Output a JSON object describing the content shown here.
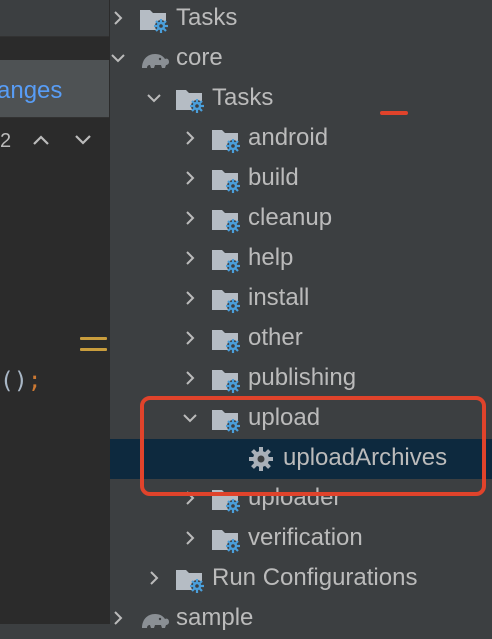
{
  "editor": {
    "changes_label": "anges",
    "change_count": "2",
    "code_tail_text": "()",
    "code_tail_semicolon": ";"
  },
  "tree": {
    "rows": [
      {
        "label": "Tasks",
        "icon": "gradle-folder-icon",
        "expanded": false,
        "level": 1
      },
      {
        "label": "core",
        "icon": "gradle-elephant-icon",
        "expanded": true,
        "level": 1
      },
      {
        "label": "Tasks",
        "icon": "gradle-folder-icon",
        "expanded": true,
        "level": 2
      },
      {
        "label": "android",
        "icon": "gradle-folder-icon",
        "expanded": false,
        "level": 3
      },
      {
        "label": "build",
        "icon": "gradle-folder-icon",
        "expanded": false,
        "level": 3
      },
      {
        "label": "cleanup",
        "icon": "gradle-folder-icon",
        "expanded": false,
        "level": 3
      },
      {
        "label": "help",
        "icon": "gradle-folder-icon",
        "expanded": false,
        "level": 3
      },
      {
        "label": "install",
        "icon": "gradle-folder-icon",
        "expanded": false,
        "level": 3
      },
      {
        "label": "other",
        "icon": "gradle-folder-icon",
        "expanded": false,
        "level": 3
      },
      {
        "label": "publishing",
        "icon": "gradle-folder-icon",
        "expanded": false,
        "level": 3
      },
      {
        "label": "upload",
        "icon": "gradle-folder-icon",
        "expanded": true,
        "level": 3
      },
      {
        "label": "uploadArchives",
        "icon": "gear-icon",
        "expanded": null,
        "level": 4
      },
      {
        "label": "uploader",
        "icon": "gradle-folder-icon",
        "expanded": false,
        "level": 3
      },
      {
        "label": "verification",
        "icon": "gradle-folder-icon",
        "expanded": false,
        "level": 3
      },
      {
        "label": "Run Configurations",
        "icon": "gradle-folder-icon",
        "expanded": false,
        "level": 2
      },
      {
        "label": "sample",
        "icon": "gradle-elephant-icon",
        "expanded": false,
        "level": 1
      }
    ],
    "selected_label": "uploadArchives"
  },
  "colors": {
    "panel_bg": "#3c3f41",
    "editor_bg": "#2b2b2b",
    "selection_bg": "#0d293e",
    "highlight_red": "#e0432b",
    "link_blue": "#589df6",
    "gear_blue": "#4a9fdb"
  }
}
